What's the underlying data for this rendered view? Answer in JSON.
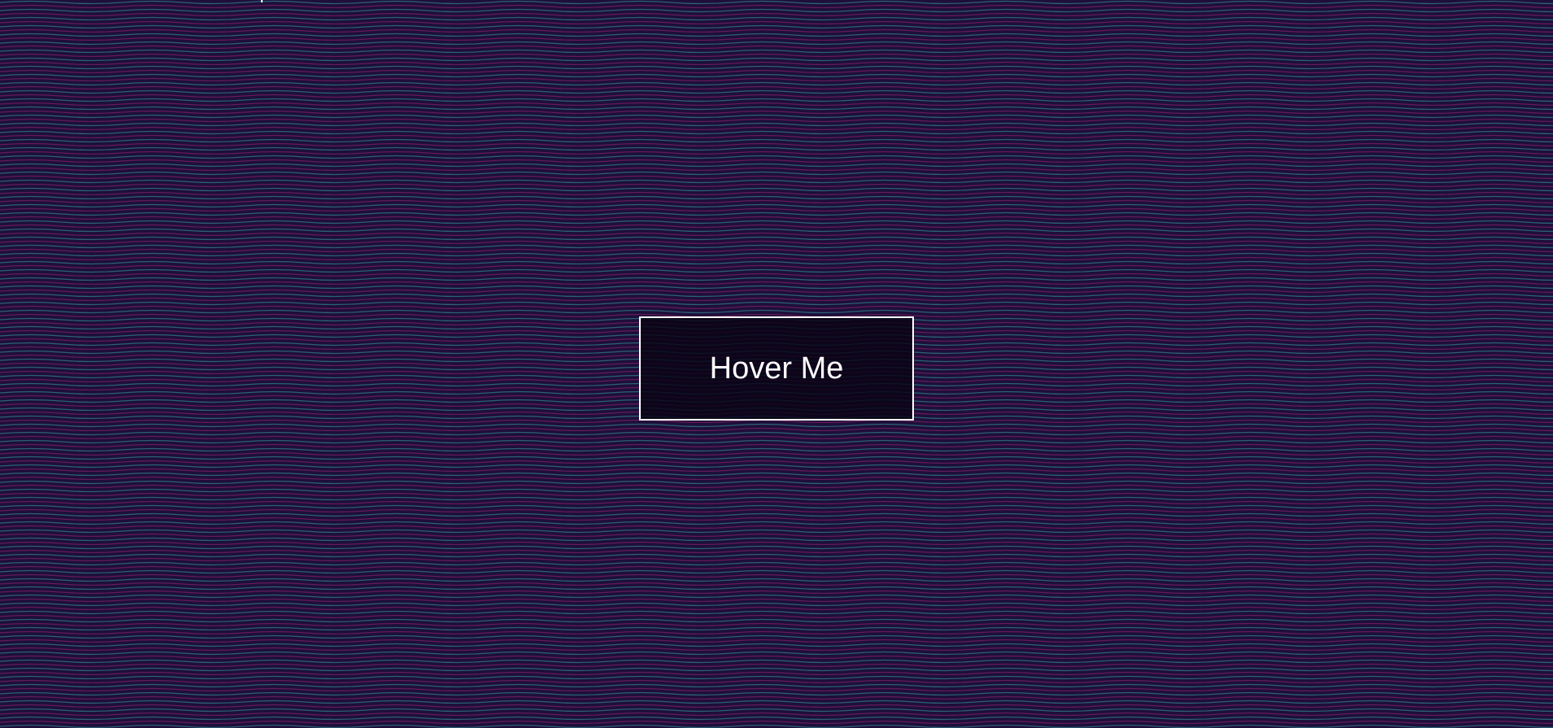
{
  "page": {
    "background_color": "#1e0f3a",
    "wave_colors": [
      "#2c6a7d",
      "#6b1d5c"
    ]
  },
  "button": {
    "label": "Hover Me",
    "border_color": "#ffffff",
    "text_color": "#ffffff"
  }
}
